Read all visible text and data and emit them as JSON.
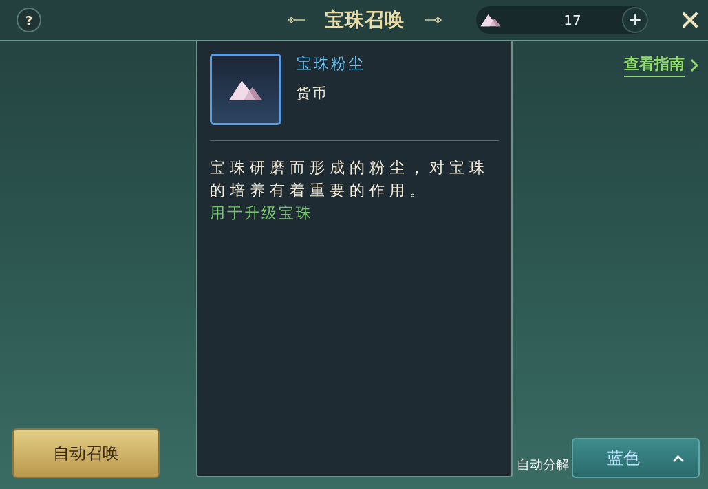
{
  "header": {
    "help_label": "?",
    "title": "宝珠召唤",
    "currency": {
      "amount": "17",
      "add_label": "+"
    }
  },
  "guide_link": "查看指南",
  "auto_summon_button": "自动召唤",
  "auto_decompose": {
    "label": "自动分解",
    "quality": "蓝色"
  },
  "tooltip": {
    "name": "宝珠粉尘",
    "type": "货币",
    "description": "宝珠研磨而形成的粉尘，对宝珠的培养有着重要的作用。",
    "usage": "用于升级宝珠"
  }
}
